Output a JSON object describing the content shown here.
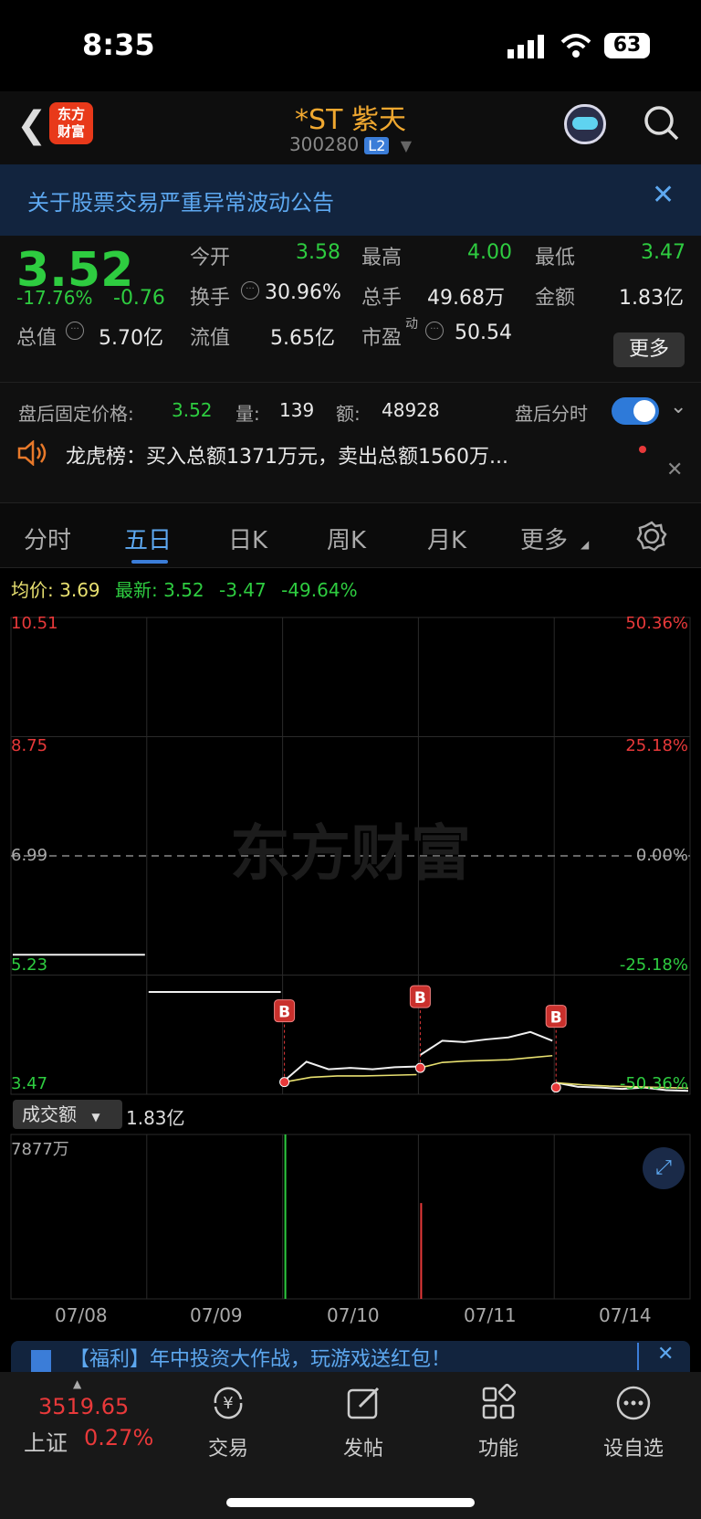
{
  "status": {
    "time": "8:35",
    "battery": "63"
  },
  "header": {
    "logo_line1": "东方",
    "logo_line2": "财富",
    "title": "*ST 紫天",
    "code": "300280",
    "badge": "L2"
  },
  "notice": {
    "text": "关于股票交易严重异常波动公告"
  },
  "quote": {
    "price": "3.52",
    "change_pct": "-17.76%",
    "change": "-0.76",
    "open_label": "今开",
    "open": "3.58",
    "high_label": "最高",
    "high": "4.00",
    "low_label": "最低",
    "low": "3.47",
    "turnover_label": "换手",
    "turnover": "30.96%",
    "volume_label": "总手",
    "volume": "49.68万",
    "amount_label": "金额",
    "amount": "1.83亿",
    "mcap_label": "总值",
    "mcap": "5.70亿",
    "float_label": "流值",
    "float": "5.65亿",
    "pe_label": "市盈",
    "pe_sup": "动",
    "pe": "50.54",
    "more": "更多"
  },
  "after_hours": {
    "label": "盘后固定价格:",
    "price": "3.52",
    "vol_label": "量:",
    "vol": "139",
    "amt_label": "额:",
    "amt": "48928",
    "toggle_label": "盘后分时"
  },
  "dragon": {
    "text": "龙虎榜：买入总额1371万元，卖出总额1560万..."
  },
  "tabs": [
    "分时",
    "五日",
    "日K",
    "周K",
    "月K",
    "更多"
  ],
  "chart_info": {
    "avg_label": "均价:",
    "avg": "3.69",
    "latest_label": "最新:",
    "latest": "3.52",
    "chg": "-3.47",
    "chg_pct": "-49.64%"
  },
  "chart_data": {
    "type": "line",
    "title": "",
    "y_left_ticks": [
      "10.51",
      "8.75",
      "6.99",
      "5.23",
      "3.47"
    ],
    "y_right_ticks": [
      "50.36%",
      "25.18%",
      "0.00%",
      "-25.18%",
      "-50.36%"
    ],
    "ylim": [
      3.47,
      10.51
    ],
    "prev_close": 6.99,
    "dates": [
      "07/08",
      "07/09",
      "07/10",
      "07/11",
      "07/14"
    ],
    "series": [
      {
        "values_by_day": [
          [
            5.53,
            5.53
          ],
          [
            4.98,
            4.98
          ],
          [
            3.67,
            3.95,
            3.84,
            3.86,
            3.84,
            3.87,
            3.88
          ],
          [
            4.05,
            4.26,
            4.24,
            4.28,
            4.31,
            4.39,
            4.26
          ],
          [
            3.64,
            3.58,
            3.57,
            3.55,
            3.57,
            3.53,
            3.52
          ]
        ]
      },
      {
        "values_by_day": [
          [],
          [],
          [
            3.65,
            3.72,
            3.74,
            3.74,
            3.75,
            3.76
          ],
          [
            3.86,
            3.94,
            3.96,
            3.97,
            3.98,
            4.01,
            4.04
          ],
          [
            3.64,
            3.61,
            3.59,
            3.58,
            3.57,
            3.56
          ]
        ]
      }
    ],
    "buy_markers": [
      {
        "day": "07/10",
        "value": 3.65
      },
      {
        "day": "07/11",
        "value": 3.86
      },
      {
        "day": "07/14",
        "value": 3.57
      }
    ],
    "marker_label": "B",
    "volume": {
      "label": "成交额",
      "total": "1.83亿",
      "max_label": "7877万",
      "spikes": [
        {
          "day": "07/10",
          "value": 7877
        },
        {
          "day": "07/11",
          "value": 4590
        }
      ]
    },
    "watermark": "东方财富"
  },
  "banner": {
    "text": "【福利】年中投资大作战，玩游戏送红包！"
  },
  "bottom": {
    "index_value": "3519.65",
    "index_name": "上证",
    "index_pct": "0.27%",
    "trade": "交易",
    "post": "发帖",
    "func": "功能",
    "watch": "设自选"
  },
  "colors": {
    "up": "#e8393a",
    "down": "#2ecc40",
    "accent": "#3b7dd8",
    "avg_line": "#e8e070"
  }
}
